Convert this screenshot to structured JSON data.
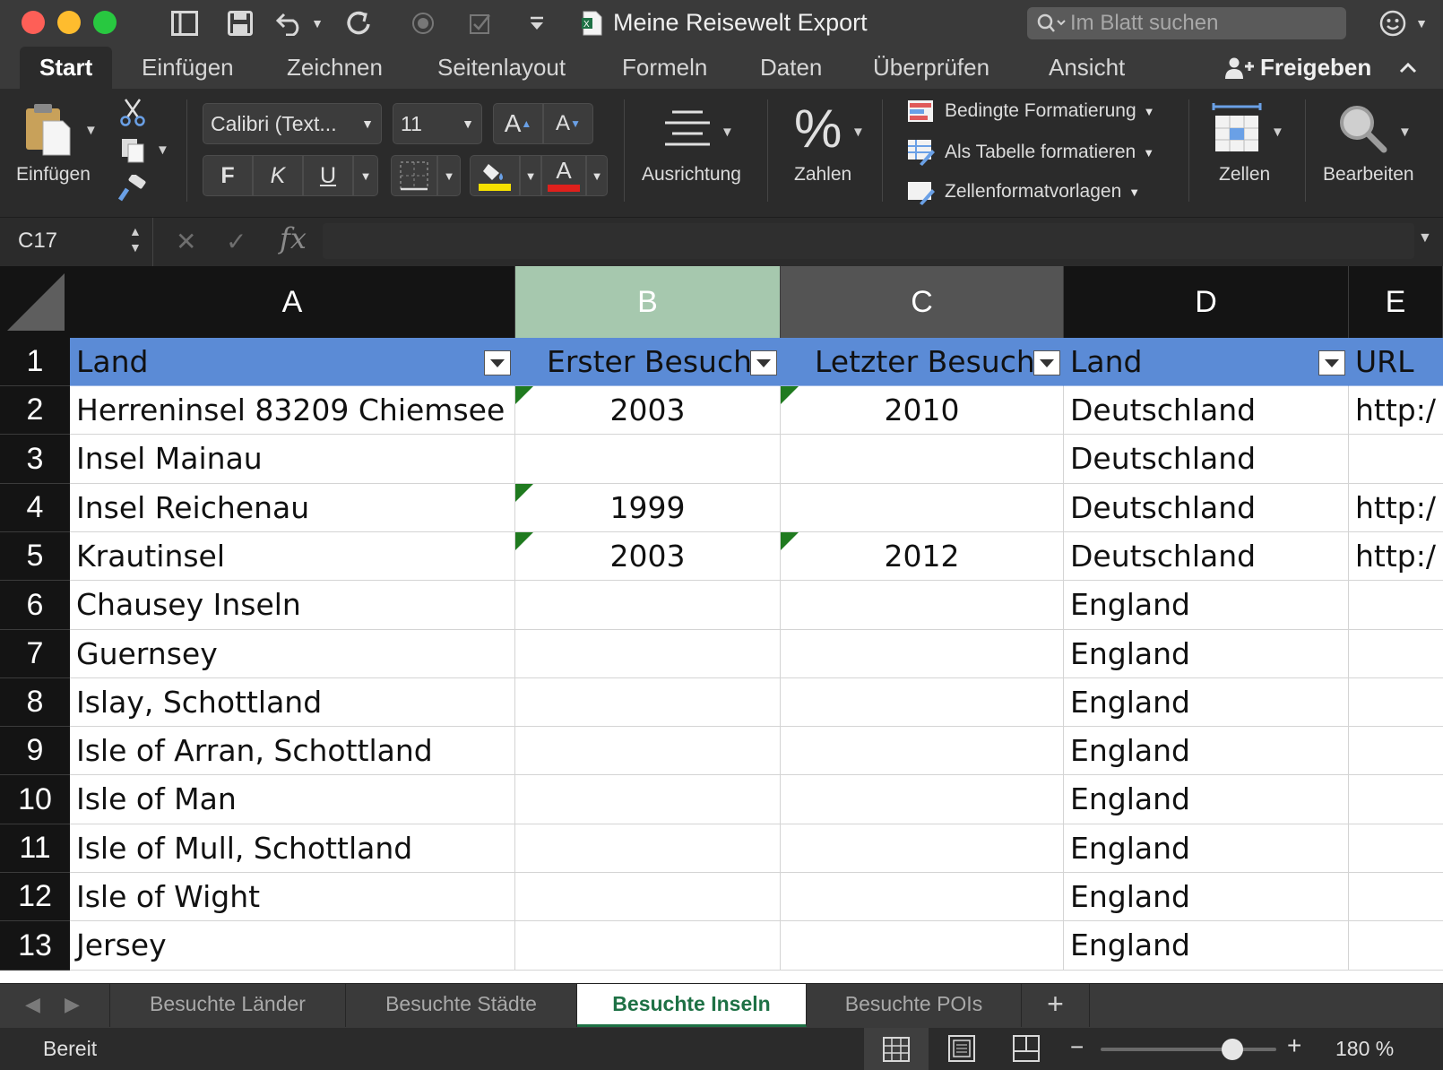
{
  "window": {
    "title": "Meine Reisewelt Export",
    "search_placeholder": "Im Blatt suchen"
  },
  "ribbon_tabs": [
    "Start",
    "Einfügen",
    "Zeichnen",
    "Seitenlayout",
    "Formeln",
    "Daten",
    "Überprüfen",
    "Ansicht"
  ],
  "share_label": "Freigeben",
  "ribbon": {
    "paste_label": "Einfügen",
    "font_name": "Calibri (Text...",
    "font_size": "11",
    "bold": "F",
    "italic": "K",
    "underline": "U",
    "grow_font": "A",
    "shrink_font": "A",
    "font_color_letter": "A",
    "alignment_label": "Ausrichtung",
    "number_label": "Zahlen",
    "number_symbol": "%",
    "conditional_formatting": "Bedingte Formatierung",
    "format_as_table": "Als Tabelle formatieren",
    "cell_styles": "Zellenformatvorlagen",
    "cells_label": "Zellen",
    "editing_label": "Bearbeiten",
    "fill_color": "#f5e000",
    "font_color": "#e0201c"
  },
  "formula_bar": {
    "name_box": "C17",
    "fx": "fx",
    "formula": ""
  },
  "grid": {
    "columns": [
      "A",
      "B",
      "C",
      "D",
      "E"
    ],
    "header_row": [
      "Land",
      "Erster Besuch",
      "Letzter Besuch",
      "Land",
      "URL"
    ],
    "rows": [
      {
        "num": "2",
        "a": "Herreninsel 83209 Chiemsee",
        "b": "2003",
        "c": "2010",
        "d": "Deutschland",
        "e": "http:/"
      },
      {
        "num": "3",
        "a": "Insel Mainau",
        "b": "",
        "c": "",
        "d": "Deutschland",
        "e": ""
      },
      {
        "num": "4",
        "a": "Insel Reichenau",
        "b": "1999",
        "c": "",
        "d": "Deutschland",
        "e": "http:/"
      },
      {
        "num": "5",
        "a": "Krautinsel",
        "b": "2003",
        "c": "2012",
        "d": "Deutschland",
        "e": "http:/"
      },
      {
        "num": "6",
        "a": "Chausey Inseln",
        "b": "",
        "c": "",
        "d": "England",
        "e": ""
      },
      {
        "num": "7",
        "a": "Guernsey",
        "b": "",
        "c": "",
        "d": "England",
        "e": ""
      },
      {
        "num": "8",
        "a": "Islay, Schottland",
        "b": "",
        "c": "",
        "d": "England",
        "e": ""
      },
      {
        "num": "9",
        "a": "Isle of Arran, Schottland",
        "b": "",
        "c": "",
        "d": "England",
        "e": ""
      },
      {
        "num": "10",
        "a": "Isle of Man",
        "b": "",
        "c": "",
        "d": "England",
        "e": ""
      },
      {
        "num": "11",
        "a": "Isle of Mull, Schottland",
        "b": "",
        "c": "",
        "d": "England",
        "e": ""
      },
      {
        "num": "12",
        "a": "Isle of Wight",
        "b": "",
        "c": "",
        "d": "England",
        "e": ""
      },
      {
        "num": "13",
        "a": "Jersey",
        "b": "",
        "c": "",
        "d": "England",
        "e": ""
      }
    ],
    "header_fill": "#5b8bd6",
    "selected_column_header": "#a6c8ae"
  },
  "sheet_tabs": [
    "Besuchte Länder",
    "Besuchte Städte",
    "Besuchte Inseln",
    "Besuchte POIs"
  ],
  "active_sheet": "Besuchte Inseln",
  "add_sheet": "+",
  "status": {
    "ready": "Bereit",
    "zoom": "180 %",
    "zoom_fraction": 0.75
  }
}
